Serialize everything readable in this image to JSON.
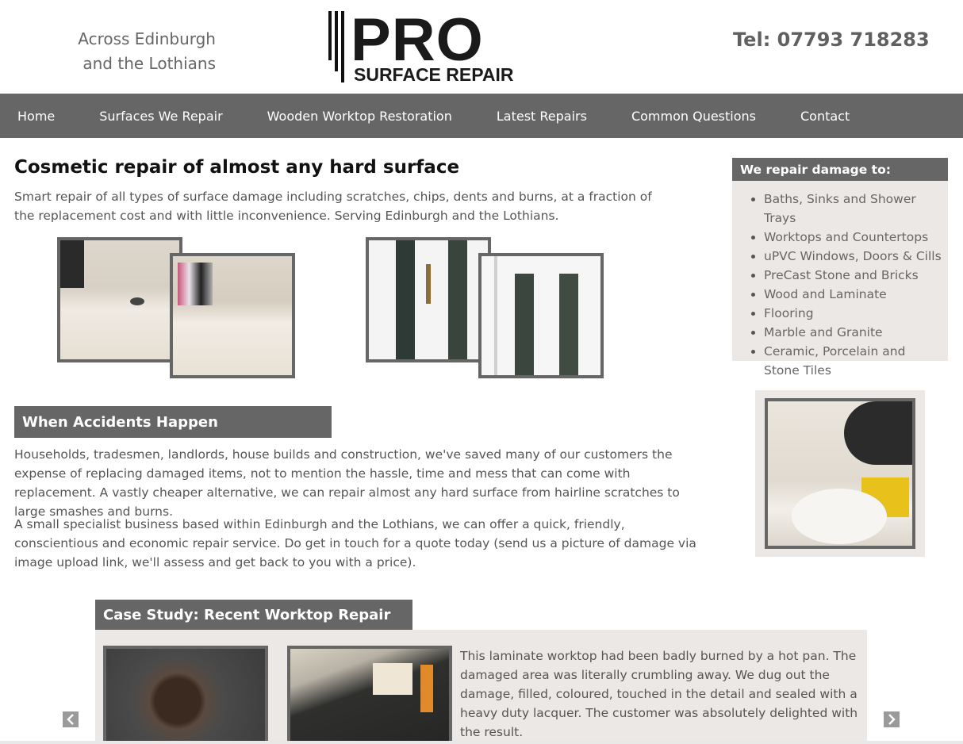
{
  "header": {
    "tagline_line1": "Across Edinburgh",
    "tagline_line2": "and the Lothians",
    "logo_main": "PRO",
    "logo_sub": "SURFACE REPAIR",
    "phone": "Tel: 07793 718283"
  },
  "nav": {
    "items": [
      {
        "label": "Home"
      },
      {
        "label": "Surfaces We Repair"
      },
      {
        "label": "Wooden Worktop Restoration"
      },
      {
        "label": "Latest Repairs"
      },
      {
        "label": "Common Questions"
      },
      {
        "label": "Contact"
      }
    ]
  },
  "main": {
    "title": "Cosmetic repair of almost any hard surface",
    "intro": "Smart repair of all types of surface damage including scratches, chips, dents and burns, at a fraction of the replacement cost and with little inconvenience. Serving Edinburgh and the Lothians.",
    "section_title": "When Accidents Happen",
    "paragraph1": "Households, tradesmen, landlords, house builds and construction, we've saved many of our customers the expense of replacing damaged items, not to mention the hassle, time and mess that can come with replacement. A vastly cheaper alternative, we can repair almost any hard surface from hairline scratches to large smashes and burns.",
    "paragraph2": "A small specialist business based within Edinburgh and the Lothians, we can offer a quick, friendly, conscientious and economic repair service. Do get in touch for a quote today (send us a picture of damage via image upload link, we'll assess and get back to you with a price)."
  },
  "sidebar": {
    "heading": "We repair damage to:",
    "items": [
      "Baths, Sinks and Shower Trays",
      "Worktops and Countertops",
      "uPVC Windows, Doors & Cills",
      "PreCast Stone and Bricks",
      "Wood and Laminate",
      "Flooring",
      "Marble and Granite",
      "Ceramic, Porcelain and Stone Tiles"
    ]
  },
  "case_study": {
    "title": "Case Study: Recent Worktop Repair",
    "text": "This laminate worktop had been badly burned by a hot pan. The damaged area was literally crumbling away. We dug out the damage, filled, coloured, touched in the detail and sealed with a heavy duty lacquer. The customer was absolutely delighted with the result.",
    "prev_icon": "chevron-left-icon",
    "next_icon": "chevron-right-icon"
  },
  "colors": {
    "nav_bg": "#666666",
    "panel_bg": "#ece8e6",
    "text": "#555555"
  }
}
